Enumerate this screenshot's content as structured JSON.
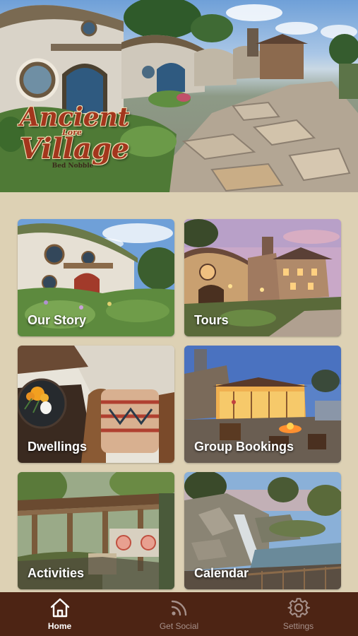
{
  "header": {
    "logo_line1": "Ancient",
    "logo_line2": "Lore",
    "logo_line3": "Village",
    "logo_line4": "Bed Nobble"
  },
  "tiles": [
    {
      "label": "Our Story"
    },
    {
      "label": "Tours"
    },
    {
      "label": "Dwellings"
    },
    {
      "label": "Group Bookings"
    },
    {
      "label": "Activities"
    },
    {
      "label": "Calendar"
    }
  ],
  "tabbar": {
    "items": [
      {
        "label": "Home",
        "icon": "home-icon",
        "active": true
      },
      {
        "label": "Get Social",
        "icon": "rss-icon",
        "active": false
      },
      {
        "label": "Settings",
        "icon": "gear-icon",
        "active": false
      }
    ]
  },
  "colors": {
    "background": "#ddd1b4",
    "tabbar": "#4d2414",
    "tab_active": "#ffffff",
    "tab_inactive": "#a6908a",
    "logo": "#a3361d"
  }
}
